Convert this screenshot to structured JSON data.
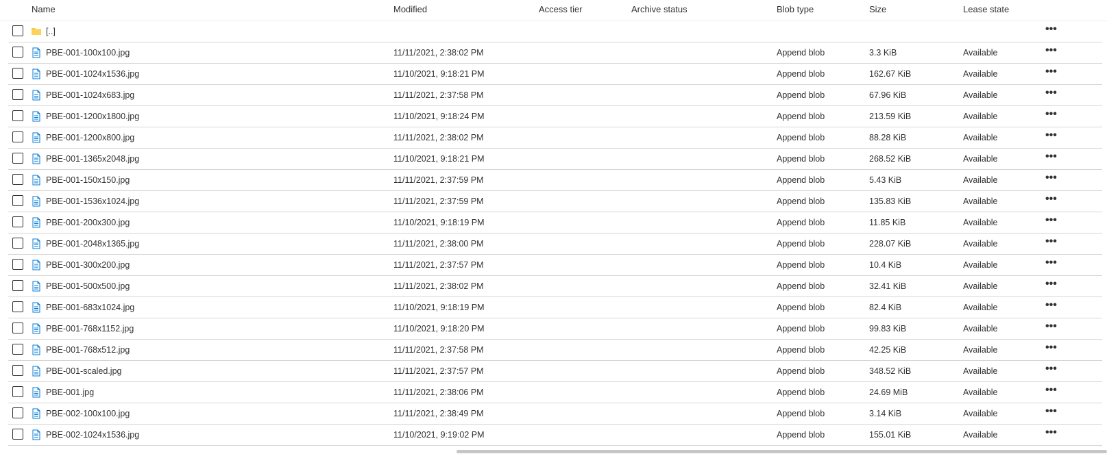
{
  "columns": {
    "name": "Name",
    "modified": "Modified",
    "access_tier": "Access tier",
    "archive_status": "Archive status",
    "blob_type": "Blob type",
    "size": "Size",
    "lease_state": "Lease state"
  },
  "parent_folder": {
    "name": "[..]",
    "icon": "folder-icon",
    "more": "•••"
  },
  "more_label": "•••",
  "file_icon": "file-icon",
  "colors": {
    "folder": "#f8c73e",
    "file": "#0078d4",
    "border": "#d6d5d3",
    "scrollbar": "#c8c6c4"
  },
  "rows": [
    {
      "name": "PBE-001-100x100.jpg",
      "modified": "11/11/2021, 2:38:02 PM",
      "blob_type": "Append blob",
      "size": "3.3 KiB",
      "lease": "Available"
    },
    {
      "name": "PBE-001-1024x1536.jpg",
      "modified": "11/10/2021, 9:18:21 PM",
      "blob_type": "Append blob",
      "size": "162.67 KiB",
      "lease": "Available"
    },
    {
      "name": "PBE-001-1024x683.jpg",
      "modified": "11/11/2021, 2:37:58 PM",
      "blob_type": "Append blob",
      "size": "67.96 KiB",
      "lease": "Available"
    },
    {
      "name": "PBE-001-1200x1800.jpg",
      "modified": "11/10/2021, 9:18:24 PM",
      "blob_type": "Append blob",
      "size": "213.59 KiB",
      "lease": "Available"
    },
    {
      "name": "PBE-001-1200x800.jpg",
      "modified": "11/11/2021, 2:38:02 PM",
      "blob_type": "Append blob",
      "size": "88.28 KiB",
      "lease": "Available"
    },
    {
      "name": "PBE-001-1365x2048.jpg",
      "modified": "11/10/2021, 9:18:21 PM",
      "blob_type": "Append blob",
      "size": "268.52 KiB",
      "lease": "Available"
    },
    {
      "name": "PBE-001-150x150.jpg",
      "modified": "11/11/2021, 2:37:59 PM",
      "blob_type": "Append blob",
      "size": "5.43 KiB",
      "lease": "Available"
    },
    {
      "name": "PBE-001-1536x1024.jpg",
      "modified": "11/11/2021, 2:37:59 PM",
      "blob_type": "Append blob",
      "size": "135.83 KiB",
      "lease": "Available"
    },
    {
      "name": "PBE-001-200x300.jpg",
      "modified": "11/10/2021, 9:18:19 PM",
      "blob_type": "Append blob",
      "size": "11.85 KiB",
      "lease": "Available"
    },
    {
      "name": "PBE-001-2048x1365.jpg",
      "modified": "11/11/2021, 2:38:00 PM",
      "blob_type": "Append blob",
      "size": "228.07 KiB",
      "lease": "Available"
    },
    {
      "name": "PBE-001-300x200.jpg",
      "modified": "11/11/2021, 2:37:57 PM",
      "blob_type": "Append blob",
      "size": "10.4 KiB",
      "lease": "Available"
    },
    {
      "name": "PBE-001-500x500.jpg",
      "modified": "11/11/2021, 2:38:02 PM",
      "blob_type": "Append blob",
      "size": "32.41 KiB",
      "lease": "Available"
    },
    {
      "name": "PBE-001-683x1024.jpg",
      "modified": "11/10/2021, 9:18:19 PM",
      "blob_type": "Append blob",
      "size": "82.4 KiB",
      "lease": "Available"
    },
    {
      "name": "PBE-001-768x1152.jpg",
      "modified": "11/10/2021, 9:18:20 PM",
      "blob_type": "Append blob",
      "size": "99.83 KiB",
      "lease": "Available"
    },
    {
      "name": "PBE-001-768x512.jpg",
      "modified": "11/11/2021, 2:37:58 PM",
      "blob_type": "Append blob",
      "size": "42.25 KiB",
      "lease": "Available"
    },
    {
      "name": "PBE-001-scaled.jpg",
      "modified": "11/11/2021, 2:37:57 PM",
      "blob_type": "Append blob",
      "size": "348.52 KiB",
      "lease": "Available"
    },
    {
      "name": "PBE-001.jpg",
      "modified": "11/11/2021, 2:38:06 PM",
      "blob_type": "Append blob",
      "size": "24.69 MiB",
      "lease": "Available"
    },
    {
      "name": "PBE-002-100x100.jpg",
      "modified": "11/11/2021, 2:38:49 PM",
      "blob_type": "Append blob",
      "size": "3.14 KiB",
      "lease": "Available"
    },
    {
      "name": "PBE-002-1024x1536.jpg",
      "modified": "11/10/2021, 9:19:02 PM",
      "blob_type": "Append blob",
      "size": "155.01 KiB",
      "lease": "Available"
    }
  ]
}
